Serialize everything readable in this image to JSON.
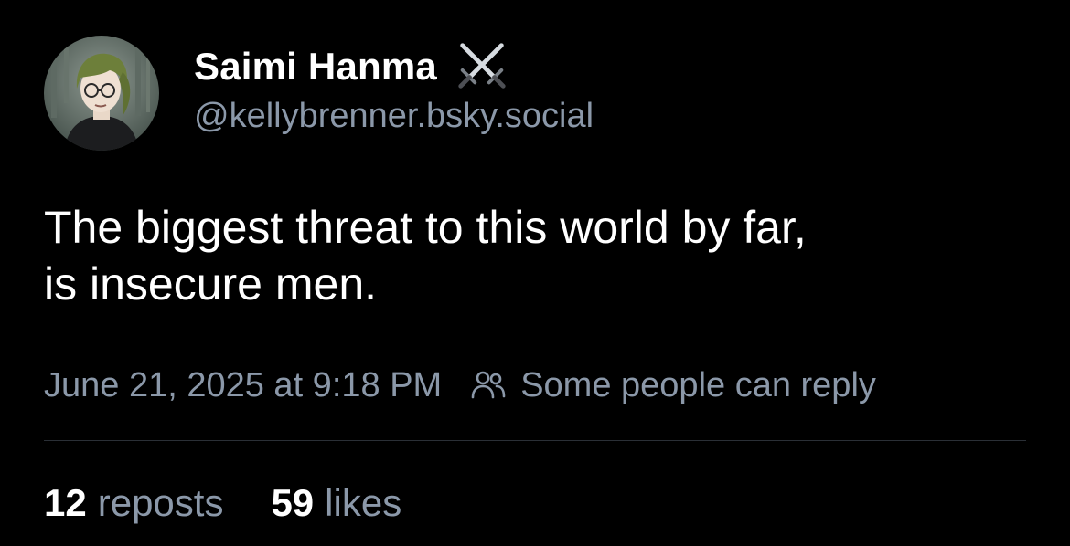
{
  "author": {
    "display_name": "Saimi Hanma",
    "name_emoji_icon": "crossed-swords-icon",
    "handle": "@kellybrenner.bsky.social",
    "avatar_icon": "avatar-illustration"
  },
  "post": {
    "text": "The biggest threat to this world by far,\nis insecure men."
  },
  "meta": {
    "timestamp": "June 21, 2025 at 9:18 PM",
    "reply_icon": "people-icon",
    "reply_setting": "Some people can reply"
  },
  "stats": {
    "reposts_count": "12",
    "reposts_label": "reposts",
    "likes_count": "59",
    "likes_label": "likes"
  },
  "colors": {
    "background": "#000000",
    "primary_text": "#ffffff",
    "secondary_text": "#8b98a9",
    "divider": "#2a2f36"
  }
}
